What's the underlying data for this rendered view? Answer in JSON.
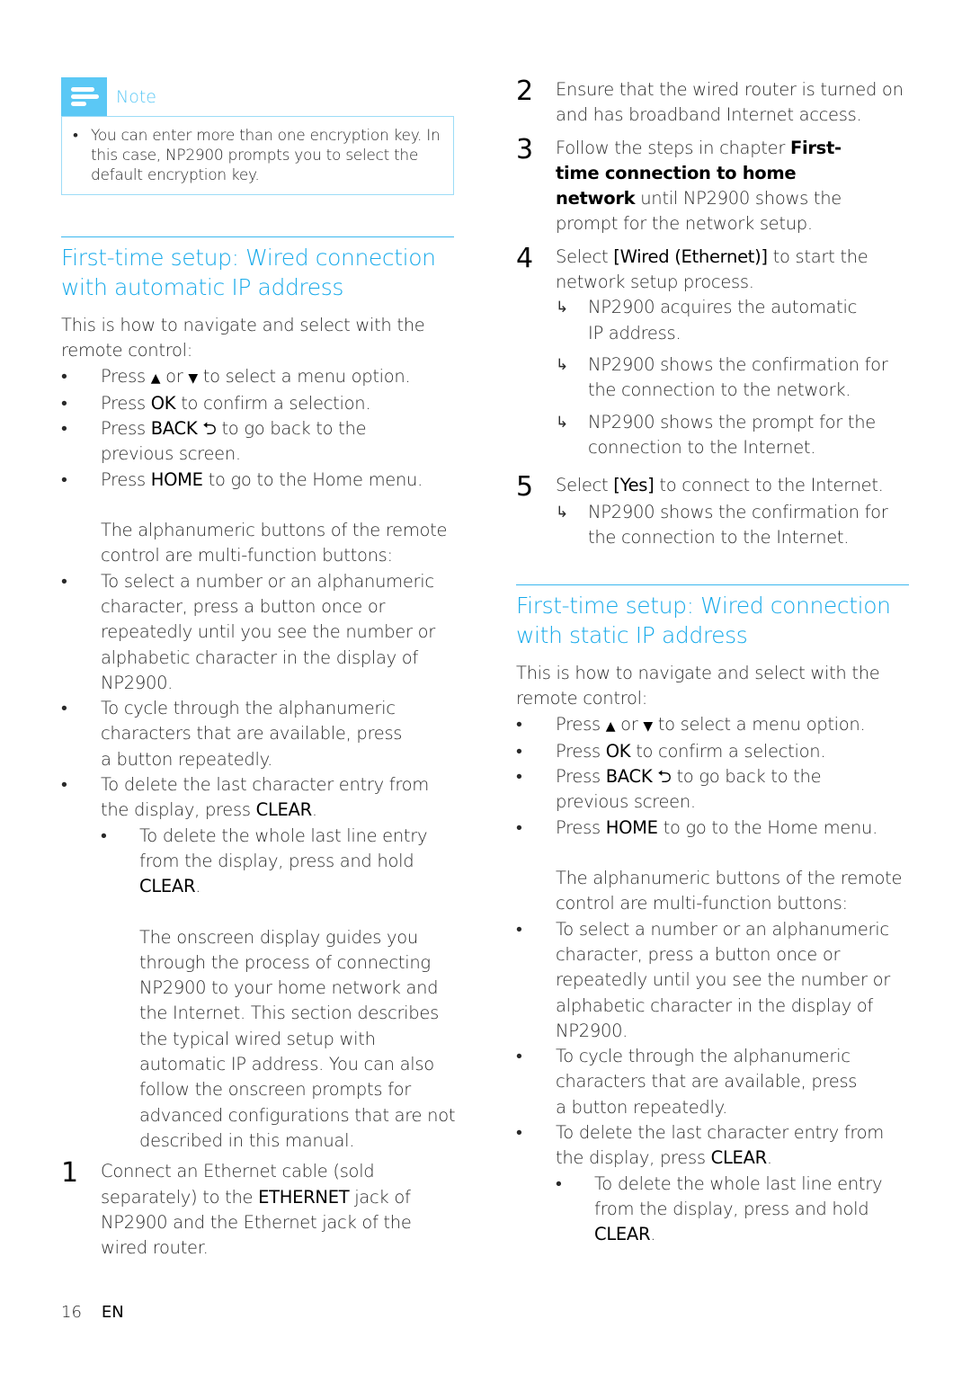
{
  "note": {
    "label": "Note",
    "items": [
      "You can enter more than one encryption key. In this case, NP2900 prompts you to select the default encryption key."
    ]
  },
  "section_auto": {
    "heading_line1": "First-time setup: Wired connection",
    "heading_line2": "with automatic IP address",
    "intro": "This is how to navigate and select with the remote control:",
    "nav": {
      "up_down": {
        "pre": "Press",
        "up": "▲",
        "or": "or",
        "down": "▼",
        "post": "to select a menu option."
      },
      "ok": {
        "pre": "Press",
        "key": "OK",
        "post": "to confirm a selection."
      },
      "back": {
        "pre": "Press",
        "key": "BACK",
        "icon": "⮌",
        "post": "to go back to the previous screen."
      },
      "home": {
        "pre": "Press",
        "key": "HOME",
        "post": "to go to the Home menu."
      }
    },
    "alnum_intro": "The alphanumeric buttons of the remote control are multi-function buttons:",
    "alnum_items": [
      "To select a number or an alphanumeric character, press a button once or repeatedly until you see the number or alphabetic character in the display of NP2900.",
      "To cycle through the alphanumeric characters that are available, press a button repeatedly."
    ],
    "delete_item": {
      "pre": "To delete the last character entry from the display, press",
      "key": "CLEAR",
      "post": "."
    },
    "delete_sub": {
      "pre": "To delete the whole last line entry from the display, press and hold",
      "key": "CLEAR",
      "post": "."
    },
    "onscreen_text": "The onscreen display guides you through the process of connecting NP2900 to your home network and the Internet. This section describes the typical wired setup with automatic IP address. You can also follow the onscreen prompts for advanced configurations that are not described in this manual.",
    "steps": [
      {
        "num": "1",
        "pre": "Connect an Ethernet cable (sold separately) to the",
        "key": "ETHERNET",
        "post": "jack of NP2900 and the Ethernet jack of the wired router."
      },
      {
        "num": "2",
        "text": "Ensure that the wired router is turned on and has broadband Internet access."
      },
      {
        "num": "3",
        "pre": "Follow the steps in chapter",
        "key": "First-time connection to home network",
        "post": "until NP2900 shows the prompt for the network setup."
      },
      {
        "num": "4",
        "pre": "Select",
        "key": "[Wired (Ethernet)]",
        "post": "to start the network setup process.",
        "results": [
          "NP2900 acquires the automatic IP address.",
          "NP2900 shows the confirmation for the connection to the network.",
          "NP2900 shows the prompt for the connection to the Internet."
        ]
      },
      {
        "num": "5",
        "pre": "Select",
        "key": "[Yes]",
        "post": "to connect to the Internet.",
        "results": [
          "NP2900 shows the confirmation for the connection to the Internet."
        ]
      }
    ],
    "result_arrow": "↳"
  },
  "section_static": {
    "heading_line1": "First-time setup: Wired connection",
    "heading_line2": "with static IP address",
    "intro": "This is how to navigate and select with the remote control:",
    "nav": {
      "up_down": {
        "pre": "Press",
        "up": "▲",
        "or": "or",
        "down": "▼",
        "post": "to select a menu option."
      },
      "ok": {
        "pre": "Press",
        "key": "OK",
        "post": "to confirm a selection."
      },
      "back": {
        "pre": "Press",
        "key": "BACK",
        "icon": "⮌",
        "post": "to go back to the previous screen."
      },
      "home": {
        "pre": "Press",
        "key": "HOME",
        "post": "to go to the Home menu."
      }
    },
    "alnum_intro": "The alphanumeric buttons of the remote control are multi-function buttons:",
    "alnum_items": [
      "To select a number or an alphanumeric character, press a button once or repeatedly until you see the number or alphabetic character in the display of NP2900.",
      "To cycle through the alphanumeric characters that are available, press a button repeatedly."
    ],
    "delete_item": {
      "pre": "To delete the last character entry from the display, press",
      "key": "CLEAR",
      "post": "."
    },
    "delete_sub": {
      "pre": "To delete the whole last line entry from the display, press and hold",
      "key": "CLEAR",
      "post": "."
    }
  },
  "bullet": "•",
  "footer": {
    "page": "16",
    "lang": "EN"
  },
  "colors": {
    "accent": "#18aaea",
    "note_icon": "#5bc8f5",
    "note_border": "#9ddcf7"
  }
}
